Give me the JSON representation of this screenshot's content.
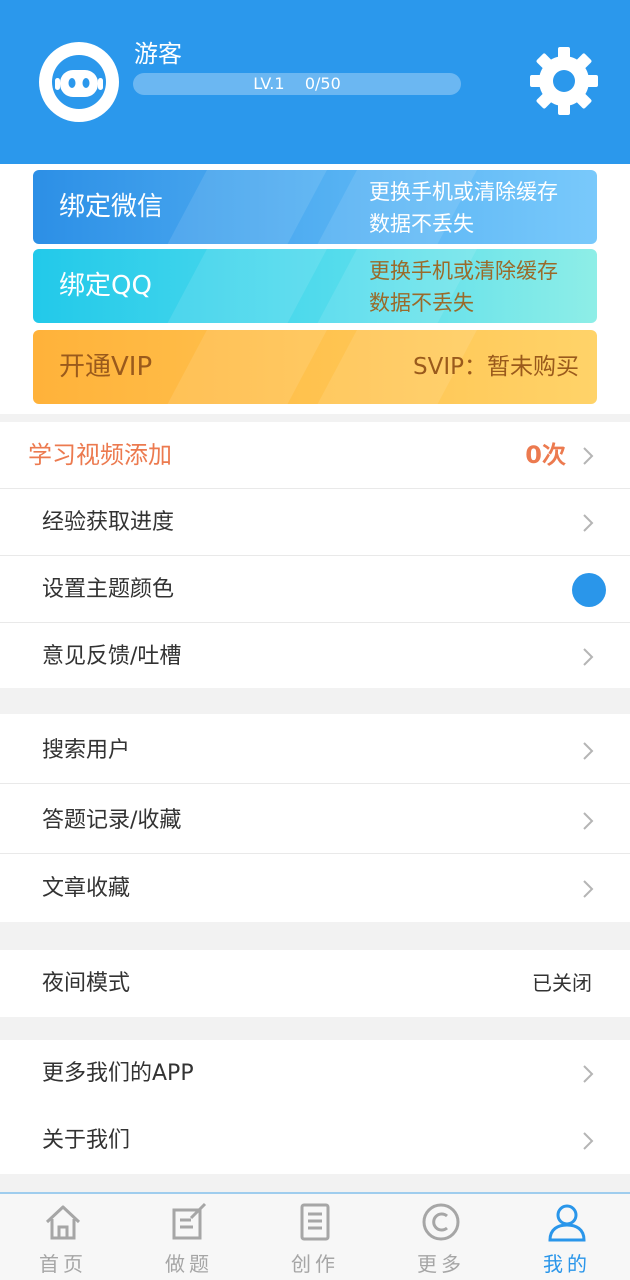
{
  "profile": {
    "username": "游客",
    "level_label": "LV.1    0/50",
    "level_progress": 0
  },
  "cards": {
    "wechat": {
      "label": "绑定微信",
      "desc_line1": "更换手机或清除缓存",
      "desc_line2": "数据不丢失"
    },
    "qq": {
      "label": "绑定QQ",
      "desc_line1": "更换手机或清除缓存",
      "desc_line2": "数据不丢失"
    },
    "vip": {
      "label": "开通VIP",
      "status": "SVIP：暂未购买"
    }
  },
  "menu": {
    "video_add": {
      "label": "学习视频添加",
      "count": "0次"
    },
    "exp_progress": "经验获取进度",
    "theme_color": {
      "label": "设置主题颜色",
      "color": "#2a96ea"
    },
    "feedback": "意见反馈/吐槽",
    "search_user": "搜索用户",
    "answer_records": "答题记录/收藏",
    "article_fav": "文章收藏",
    "night_mode": {
      "label": "夜间模式",
      "status": "已关闭"
    },
    "more_apps": "更多我们的APP",
    "about_us": "关于我们"
  },
  "tabs": [
    {
      "label": "首页",
      "icon": "home-icon"
    },
    {
      "label": "做题",
      "icon": "edit-icon"
    },
    {
      "label": "创作",
      "icon": "document-icon"
    },
    {
      "label": "更多",
      "icon": "copyright-icon"
    },
    {
      "label": "我的",
      "icon": "user-icon",
      "active": true
    }
  ],
  "colors": {
    "primary": "#2b98ec",
    "accent_orange": "#ec7a4f",
    "vip_gold": "#ffc451"
  }
}
